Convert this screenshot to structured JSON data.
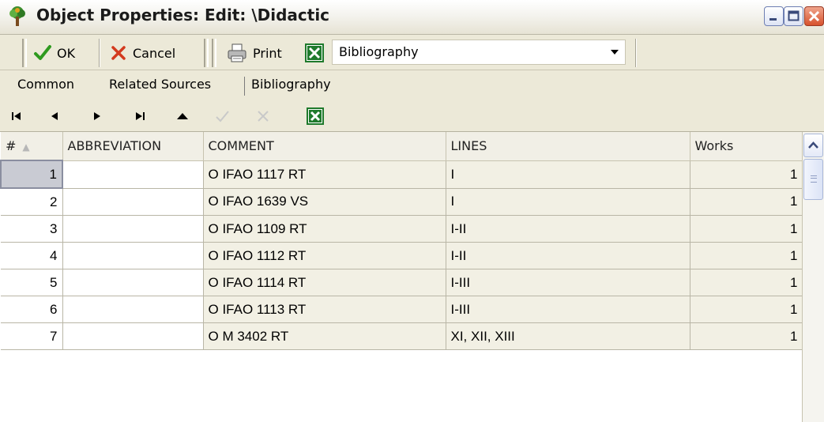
{
  "window": {
    "title": "Object Properties: Edit: \\Didactic"
  },
  "toolbar": {
    "ok_label": "OK",
    "cancel_label": "Cancel",
    "print_label": "Print",
    "report_select_value": "Bibliography"
  },
  "tabs": [
    {
      "label": "Common"
    },
    {
      "label": "Related Sources"
    },
    {
      "label": "Bibliography"
    }
  ],
  "grid": {
    "columns": [
      "#",
      "ABBREVIATION",
      "COMMENT",
      "LINES",
      "Works"
    ],
    "rows": [
      {
        "num": "1",
        "abbreviation": "",
        "comment": "O IFAO 1117 RT",
        "lines": "I",
        "works": "1"
      },
      {
        "num": "2",
        "abbreviation": "",
        "comment": "O IFAO 1639 VS",
        "lines": "I",
        "works": "1"
      },
      {
        "num": "3",
        "abbreviation": "",
        "comment": "O IFAO 1109 RT",
        "lines": "I-II",
        "works": "1"
      },
      {
        "num": "4",
        "abbreviation": "",
        "comment": "O IFAO 1112 RT",
        "lines": "I-II",
        "works": "1"
      },
      {
        "num": "5",
        "abbreviation": "",
        "comment": "O IFAO 1114 RT",
        "lines": "I-III",
        "works": "1"
      },
      {
        "num": "6",
        "abbreviation": "",
        "comment": "O IFAO 1113 RT",
        "lines": "I-III",
        "works": "1"
      },
      {
        "num": "7",
        "abbreviation": "",
        "comment": "O M 3402 RT",
        "lines": "XI, XII, XIII",
        "works": "1"
      }
    ]
  },
  "colors": {
    "window_bg": "#ece9d8",
    "grid_tan": "#f2f0e4",
    "ok_check": "#2f9a1f",
    "cancel_x": "#d33a1e",
    "excel_green": "#1f7a2c"
  }
}
